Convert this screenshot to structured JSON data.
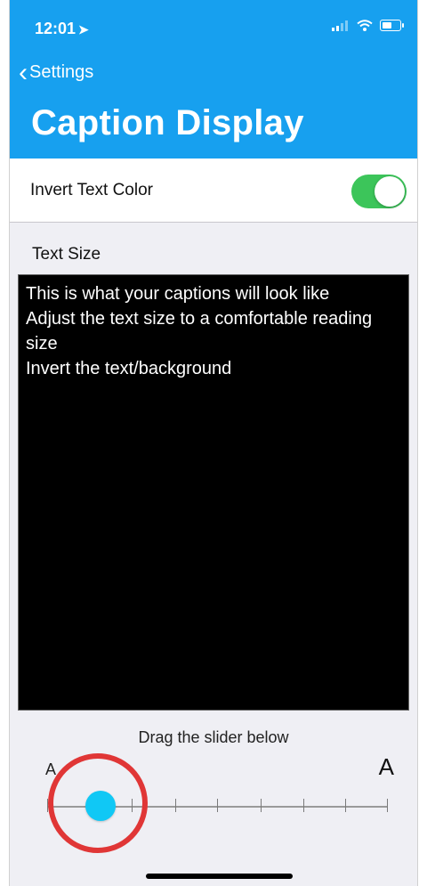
{
  "status_bar": {
    "time": "12:01",
    "location_icon": "location-arrow-icon",
    "icons": [
      "cellular-signal-icon",
      "wifi-icon",
      "battery-icon"
    ]
  },
  "nav": {
    "back_label": "Settings",
    "title": "Caption Display"
  },
  "invert_row": {
    "label": "Invert Text Color",
    "toggle_on": true
  },
  "text_size": {
    "label": "Text Size",
    "preview_lines": [
      "This is what your captions will look like",
      "Adjust the text size to a comfortable reading size",
      "Invert the text/background"
    ]
  },
  "slider": {
    "hint": "Drag the slider below",
    "min_label": "A",
    "max_label": "A",
    "ticks": 8,
    "selected_step": 1
  },
  "colors": {
    "header": "#17a0ef",
    "toggle_on": "#3cc55a",
    "slider_thumb": "#10c8f5",
    "highlight_ring": "#e03636"
  }
}
